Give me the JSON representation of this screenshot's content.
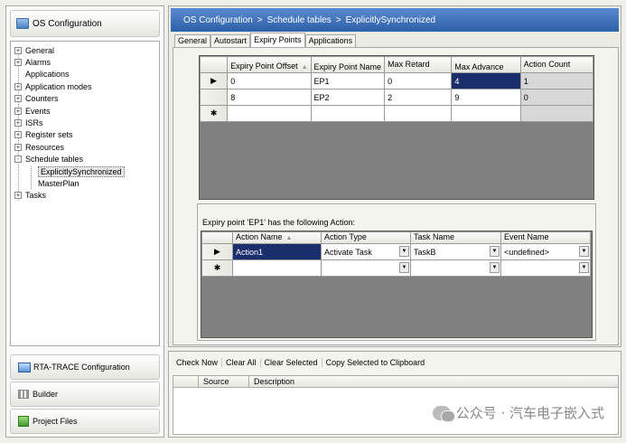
{
  "left": {
    "header": "OS Configuration",
    "tree": [
      {
        "label": "General",
        "expander": "+"
      },
      {
        "label": "Alarms",
        "expander": "+"
      },
      {
        "label": "Applications",
        "expander": ""
      },
      {
        "label": "Application modes",
        "expander": "+"
      },
      {
        "label": "Counters",
        "expander": "+"
      },
      {
        "label": "Events",
        "expander": "+"
      },
      {
        "label": "ISRs",
        "expander": "+"
      },
      {
        "label": "Register sets",
        "expander": "+"
      },
      {
        "label": "Resources",
        "expander": "+"
      },
      {
        "label": "Schedule tables",
        "expander": "-"
      },
      {
        "label": "ExplicitlySynchronized",
        "expander": ""
      },
      {
        "label": "MasterPlan",
        "expander": ""
      },
      {
        "label": "Tasks",
        "expander": "+"
      }
    ],
    "nav": [
      "RTA-TRACE Configuration",
      "Builder",
      "Project Files"
    ]
  },
  "breadcrumb": [
    "OS Configuration",
    "Schedule tables",
    "ExplicitlySynchronized"
  ],
  "breadcrumb_sep": ">",
  "tabs": [
    "General",
    "Autostart",
    "Expiry Points",
    "Applications"
  ],
  "expiry_table": {
    "headers": [
      "Expiry Point Offset",
      "Expiry Point Name",
      "Max Retard",
      "Max Advance",
      "Action Count"
    ],
    "rows": [
      {
        "marker": "▶",
        "cells": [
          "0",
          "EP1",
          "0",
          "4",
          "1"
        ]
      },
      {
        "marker": "",
        "cells": [
          "8",
          "EP2",
          "2",
          "9",
          "0"
        ]
      },
      {
        "marker": "✱",
        "cells": [
          "",
          "",
          "",
          "",
          ""
        ]
      }
    ]
  },
  "action_caption": "Expiry point 'EP1' has the following Action:",
  "action_table": {
    "headers": [
      "Action Name",
      "Action Type",
      "Task Name",
      "Event Name"
    ],
    "rows": [
      {
        "marker": "▶",
        "cells": [
          "Action1",
          "Activate Task",
          "TaskB",
          "<undefined>"
        ]
      },
      {
        "marker": "✱",
        "cells": [
          "",
          "",
          "",
          ""
        ]
      }
    ]
  },
  "output": {
    "toolbar": [
      "Check Now",
      "Clear All",
      "Clear Selected",
      "Copy Selected to Clipboard"
    ],
    "columns": [
      "Source",
      "Description"
    ]
  },
  "watermark": "公众号 · 汽车电子嵌入式",
  "icons": {
    "sort": "sort-up-icon",
    "dropdown": "chevron-down-icon",
    "current_row": "row-pointer-icon",
    "new_row": "new-row-icon"
  },
  "colors": {
    "breadcrumb_bg": "#2d5fa8",
    "selection": "#1a2e6e",
    "grid_empty": "#808080"
  }
}
